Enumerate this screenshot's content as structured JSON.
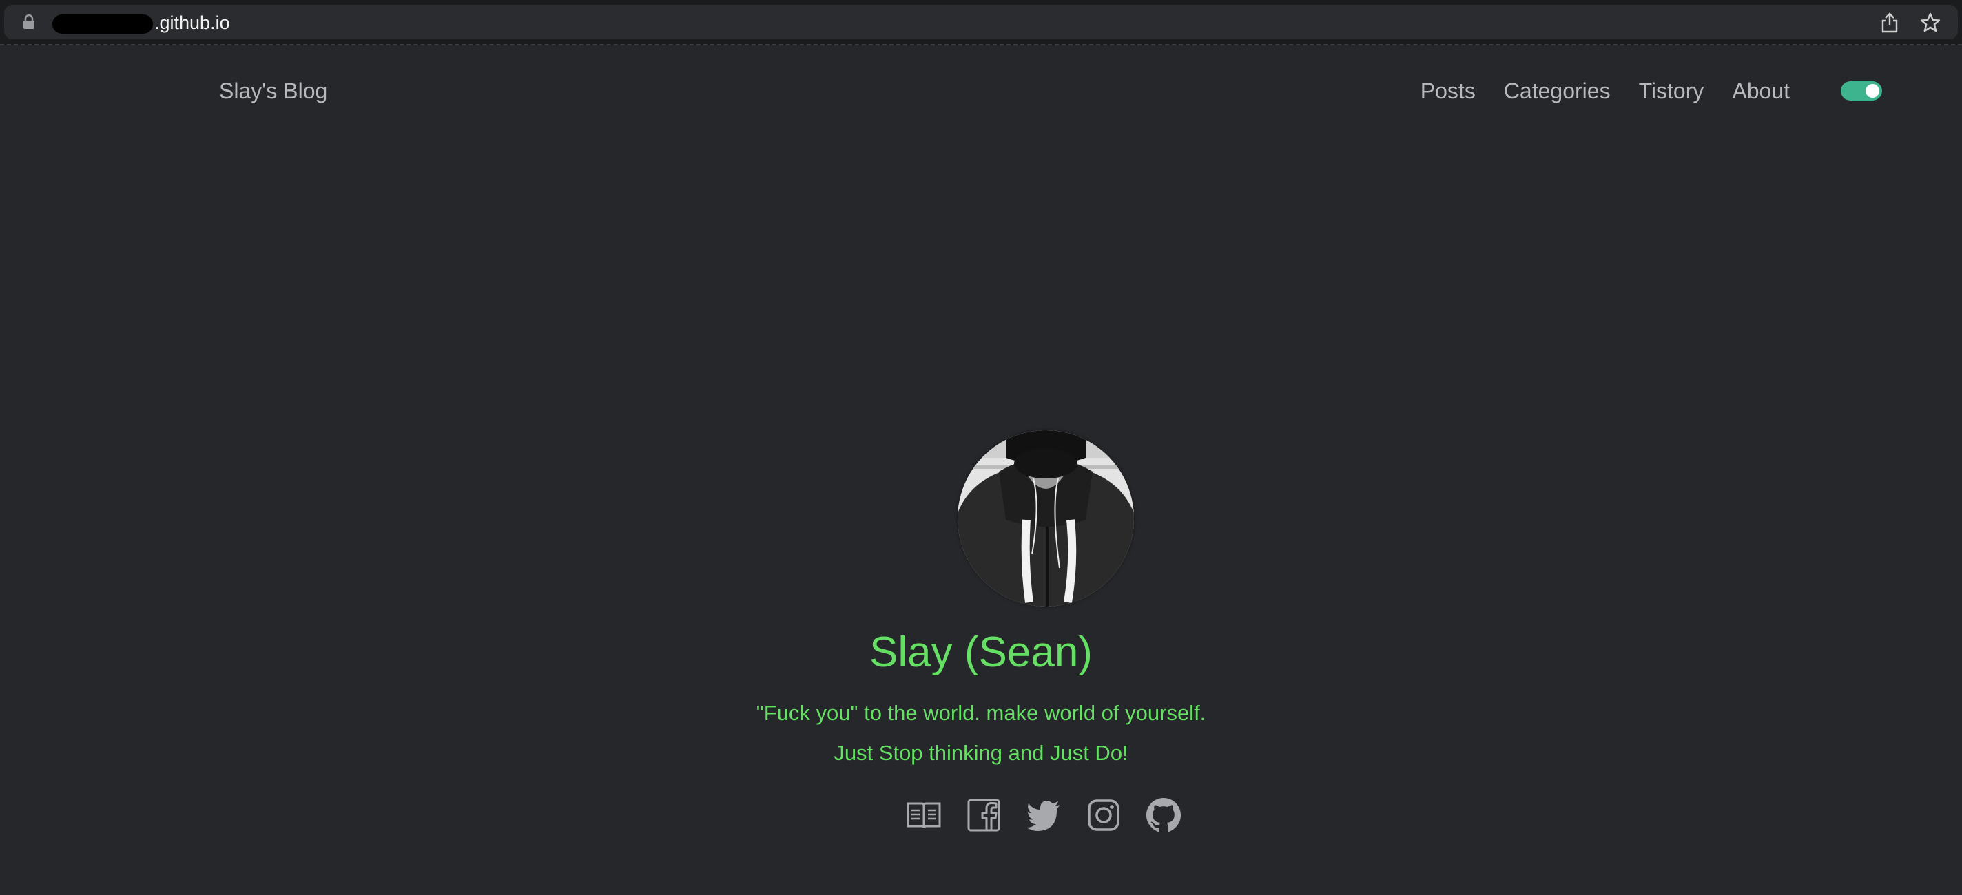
{
  "browser": {
    "url_visible_text": ".github.io",
    "url_redacted": true
  },
  "site": {
    "title": "Slay's Blog",
    "nav": [
      {
        "label": "Posts"
      },
      {
        "label": "Categories"
      },
      {
        "label": "Tistory"
      },
      {
        "label": "About"
      }
    ],
    "theme_toggle": {
      "state": "on",
      "color": "#3db38e"
    }
  },
  "profile": {
    "name": "Slay (Sean)",
    "bio_line1": "\"Fuck you\" to the world. make world of yourself.",
    "bio_line2": "Just Stop thinking and Just Do!",
    "accent_color": "#66e064",
    "social_icons": [
      "blog-book-icon",
      "facebook-icon",
      "twitter-icon",
      "instagram-icon",
      "github-icon"
    ]
  },
  "colors": {
    "background": "#25272a",
    "nav_text": "#b8b9bc"
  }
}
